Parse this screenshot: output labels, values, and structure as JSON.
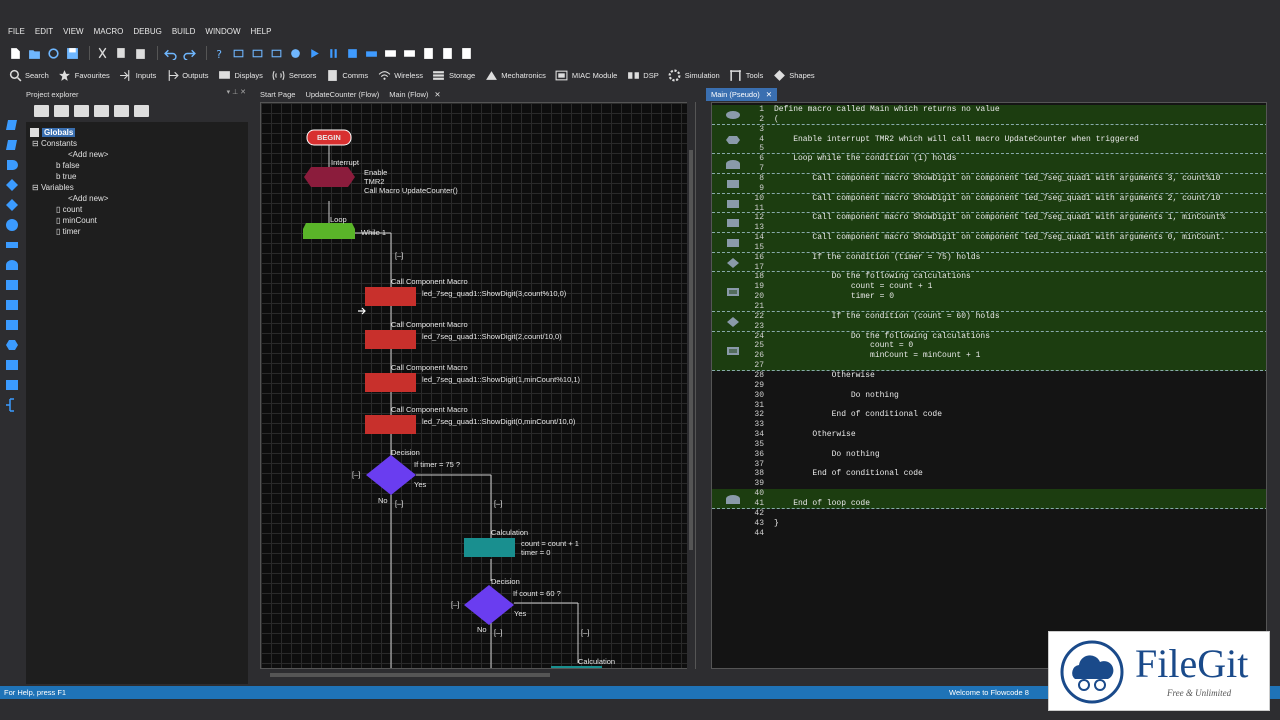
{
  "menu": [
    "FILE",
    "EDIT",
    "VIEW",
    "MACRO",
    "DEBUG",
    "BUILD",
    "WINDOW",
    "HELP"
  ],
  "categories": [
    {
      "icon": "search-icon",
      "label": "Search"
    },
    {
      "icon": "star-icon",
      "label": "Favourites"
    },
    {
      "icon": "inputs-icon",
      "label": "Inputs"
    },
    {
      "icon": "outputs-icon",
      "label": "Outputs"
    },
    {
      "icon": "displays-icon",
      "label": "Displays"
    },
    {
      "icon": "sensors-icon",
      "label": "Sensors"
    },
    {
      "icon": "comms-icon",
      "label": "Comms"
    },
    {
      "icon": "wireless-icon",
      "label": "Wireless"
    },
    {
      "icon": "storage-icon",
      "label": "Storage"
    },
    {
      "icon": "mechatronics-icon",
      "label": "Mechatronics"
    },
    {
      "icon": "miac-icon",
      "label": "MIAC Module"
    },
    {
      "icon": "dsp-icon",
      "label": "DSP"
    },
    {
      "icon": "simulation-icon",
      "label": "Simulation"
    },
    {
      "icon": "tools-icon",
      "label": "Tools"
    },
    {
      "icon": "shapes-icon",
      "label": "Shapes"
    }
  ],
  "project": {
    "title": "Project explorer",
    "header_controls": "▾ ⊥ ✕",
    "tree": {
      "globals": "Globals",
      "constants": "Constants",
      "add_new_1": "<Add new>",
      "false": "false",
      "true": "true",
      "variables": "Variables",
      "add_new_2": "<Add new>",
      "count": "count",
      "minCount": "minCount",
      "timer": "timer"
    }
  },
  "flow_tabs": [
    "Start Page",
    "UpdateCounter (Flow)",
    "Main (Flow)"
  ],
  "flow": {
    "begin": "BEGIN",
    "interrupt_label": "Interrupt",
    "interrupt_text1": "Enable",
    "interrupt_text2": "TMR2",
    "interrupt_text3": "Call Macro UpdateCounter()",
    "loop_label": "Loop",
    "loop_cond": "While 1",
    "collapse": "[–]",
    "call_label": "Call Component Macro",
    "call1": "led_7seg_quad1::ShowDigit(3,count%10,0)",
    "call2": "led_7seg_quad1::ShowDigit(2,count/10,0)",
    "call3": "led_7seg_quad1::ShowDigit(1,minCount%10,1)",
    "call4": "led_7seg_quad1::ShowDigit(0,minCount/10,0)",
    "decision_label": "Decision",
    "dec1": "If timer = 75 ?",
    "yes": "Yes",
    "no": "No",
    "calc_label": "Calculation",
    "calc1a": "count = count + 1",
    "calc1b": "timer = 0",
    "dec2": "If count = 60 ?"
  },
  "pseudo_tab": "Main (Pseudo)",
  "pseudo_lines": [
    "Define macro called Main which returns no value",
    "(",
    "",
    "    Enable interrupt TMR2 which will call macro UpdateCounter when triggered",
    "",
    "    Loop while the condition (1) holds",
    "",
    "        Call component macro ShowDigit on component led_7seg_quad1 with arguments 3, count%10",
    "",
    "        Call component macro ShowDigit on component led_7seg_quad1 with arguments 2, count/10",
    "",
    "        Call component macro ShowDigit on component led_7seg_quad1 with arguments 1, minCount%",
    "",
    "        Call component macro ShowDigit on component led_7seg_quad1 with arguments 0, minCount.",
    "",
    "        If the condition (timer = 75) holds",
    "",
    "            Do the following calculations",
    "                count = count + 1",
    "                timer = 0",
    "",
    "            If the condition (count = 60) holds",
    "",
    "                Do the following calculations",
    "                    count = 0",
    "                    minCount = minCount + 1",
    "",
    "            Otherwise",
    "",
    "                Do nothing",
    "",
    "            End of conditional code",
    "",
    "        Otherwise",
    "",
    "            Do nothing",
    "",
    "        End of conditional code",
    "",
    "",
    "    End of loop code",
    "",
    "}",
    ""
  ],
  "status": {
    "left": "For Help, press F1",
    "right": "Welcome to Flowcode 8"
  },
  "watermark": {
    "brand": "FileGit",
    "tagline": "Free & Unlimited"
  }
}
